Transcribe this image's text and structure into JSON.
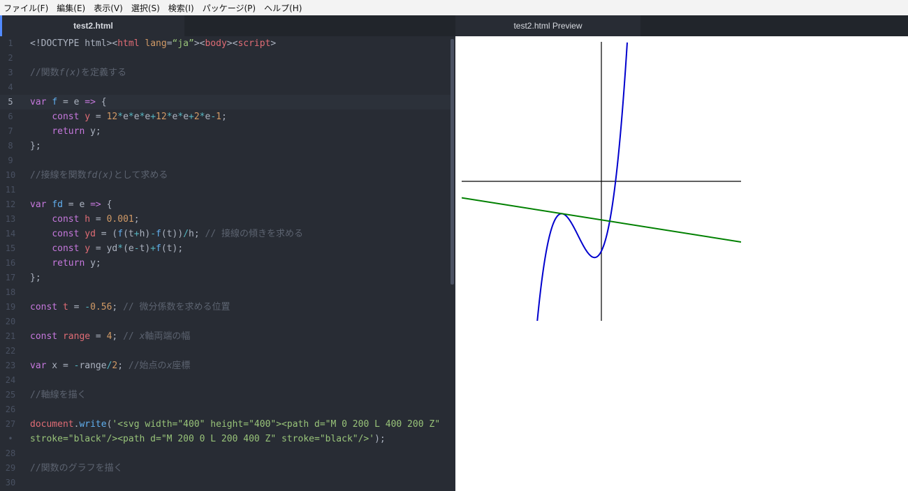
{
  "menu": [
    "ファイル(F)",
    "編集(E)",
    "表示(V)",
    "選択(S)",
    "検索(I)",
    "パッケージ(P)",
    "ヘルプ(H)"
  ],
  "tabs": {
    "editor": "test2.html",
    "preview": "test2.html Preview"
  },
  "editor": {
    "active_line": 5,
    "lines": [
      {
        "n": "1",
        "tokens": [
          [
            "<!DOCTYPE html>",
            "pl"
          ],
          [
            "<",
            "pl"
          ],
          [
            "html",
            "tag"
          ],
          [
            " ",
            "pl"
          ],
          [
            "lang",
            "attr"
          ],
          [
            "=",
            "pl"
          ],
          [
            "“ja”",
            "str"
          ],
          [
            ">",
            "pl"
          ],
          [
            "<",
            "pl"
          ],
          [
            "body",
            "tag"
          ],
          [
            "><",
            "pl"
          ],
          [
            "script",
            "tag"
          ],
          [
            ">",
            "pl"
          ]
        ]
      },
      {
        "n": "2",
        "tokens": []
      },
      {
        "n": "3",
        "tokens": [
          [
            "//関数",
            "cmt"
          ],
          [
            "f(x)",
            "cmt it"
          ],
          [
            "を定義する",
            "cmt"
          ]
        ]
      },
      {
        "n": "4",
        "tokens": []
      },
      {
        "n": "5",
        "tokens": [
          [
            "var",
            "kw"
          ],
          [
            " ",
            "pl"
          ],
          [
            "f",
            "fn"
          ],
          [
            " = e ",
            "pl"
          ],
          [
            "=>",
            "kw"
          ],
          [
            " {",
            "pl"
          ]
        ]
      },
      {
        "n": "6",
        "tokens": [
          [
            "    ",
            "pl"
          ],
          [
            "const",
            "kw"
          ],
          [
            " ",
            "pl"
          ],
          [
            "y",
            "var"
          ],
          [
            " = ",
            "pl"
          ],
          [
            "12",
            "num"
          ],
          [
            "*",
            "op"
          ],
          [
            "e",
            "pl"
          ],
          [
            "*",
            "op"
          ],
          [
            "e",
            "pl"
          ],
          [
            "*",
            "op"
          ],
          [
            "e",
            "pl"
          ],
          [
            "+",
            "op"
          ],
          [
            "12",
            "num"
          ],
          [
            "*",
            "op"
          ],
          [
            "e",
            "pl"
          ],
          [
            "*",
            "op"
          ],
          [
            "e",
            "pl"
          ],
          [
            "+",
            "op"
          ],
          [
            "2",
            "num"
          ],
          [
            "*",
            "op"
          ],
          [
            "e",
            "pl"
          ],
          [
            "-",
            "op"
          ],
          [
            "1",
            "num"
          ],
          [
            ";",
            "pl"
          ]
        ]
      },
      {
        "n": "7",
        "tokens": [
          [
            "    ",
            "pl"
          ],
          [
            "return",
            "kw"
          ],
          [
            " y;",
            "pl"
          ]
        ]
      },
      {
        "n": "8",
        "tokens": [
          [
            "};",
            "pl"
          ]
        ]
      },
      {
        "n": "9",
        "tokens": []
      },
      {
        "n": "10",
        "tokens": [
          [
            "//接線を関数",
            "cmt"
          ],
          [
            "fd(x)",
            "cmt it"
          ],
          [
            "として求める",
            "cmt"
          ]
        ]
      },
      {
        "n": "11",
        "tokens": []
      },
      {
        "n": "12",
        "tokens": [
          [
            "var",
            "kw"
          ],
          [
            " ",
            "pl"
          ],
          [
            "fd",
            "fn"
          ],
          [
            " = e ",
            "pl"
          ],
          [
            "=>",
            "kw"
          ],
          [
            " {",
            "pl"
          ]
        ]
      },
      {
        "n": "13",
        "tokens": [
          [
            "    ",
            "pl"
          ],
          [
            "const",
            "kw"
          ],
          [
            " ",
            "pl"
          ],
          [
            "h",
            "var"
          ],
          [
            " = ",
            "pl"
          ],
          [
            "0.001",
            "num"
          ],
          [
            ";",
            "pl"
          ]
        ]
      },
      {
        "n": "14",
        "tokens": [
          [
            "    ",
            "pl"
          ],
          [
            "const",
            "kw"
          ],
          [
            " ",
            "pl"
          ],
          [
            "yd",
            "var"
          ],
          [
            " = (",
            "pl"
          ],
          [
            "f",
            "fn"
          ],
          [
            "(t",
            "pl"
          ],
          [
            "+",
            "op"
          ],
          [
            "h)",
            "pl"
          ],
          [
            "-",
            "op"
          ],
          [
            "f",
            "fn"
          ],
          [
            "(t))",
            "pl"
          ],
          [
            "/",
            "op"
          ],
          [
            "h; ",
            "pl"
          ],
          [
            "// 接線の傾きを求める",
            "cmt"
          ]
        ]
      },
      {
        "n": "15",
        "tokens": [
          [
            "    ",
            "pl"
          ],
          [
            "const",
            "kw"
          ],
          [
            " ",
            "pl"
          ],
          [
            "y",
            "var"
          ],
          [
            " = yd",
            "pl"
          ],
          [
            "*",
            "op"
          ],
          [
            "(e",
            "pl"
          ],
          [
            "-",
            "op"
          ],
          [
            "t)",
            "pl"
          ],
          [
            "+",
            "op"
          ],
          [
            "f",
            "fn"
          ],
          [
            "(t);",
            "pl"
          ]
        ]
      },
      {
        "n": "16",
        "tokens": [
          [
            "    ",
            "pl"
          ],
          [
            "return",
            "kw"
          ],
          [
            " y;",
            "pl"
          ]
        ]
      },
      {
        "n": "17",
        "tokens": [
          [
            "};",
            "pl"
          ]
        ]
      },
      {
        "n": "18",
        "tokens": []
      },
      {
        "n": "19",
        "tokens": [
          [
            "const",
            "kw"
          ],
          [
            " ",
            "pl"
          ],
          [
            "t",
            "var"
          ],
          [
            " = ",
            "pl"
          ],
          [
            "-",
            "op"
          ],
          [
            "0.56",
            "num"
          ],
          [
            "; ",
            "pl"
          ],
          [
            "// 微分係数を求める位置",
            "cmt"
          ]
        ]
      },
      {
        "n": "20",
        "tokens": []
      },
      {
        "n": "21",
        "tokens": [
          [
            "const",
            "kw"
          ],
          [
            " ",
            "pl"
          ],
          [
            "range",
            "var"
          ],
          [
            " = ",
            "pl"
          ],
          [
            "4",
            "num"
          ],
          [
            "; ",
            "pl"
          ],
          [
            "// ",
            "cmt"
          ],
          [
            "x",
            "cmt it"
          ],
          [
            "軸両端の幅",
            "cmt"
          ]
        ]
      },
      {
        "n": "22",
        "tokens": []
      },
      {
        "n": "23",
        "tokens": [
          [
            "var",
            "kw"
          ],
          [
            " x = ",
            "pl"
          ],
          [
            "-",
            "op"
          ],
          [
            "range",
            "pl"
          ],
          [
            "/",
            "op"
          ],
          [
            "2",
            "num"
          ],
          [
            "; ",
            "pl"
          ],
          [
            "//始点の",
            "cmt"
          ],
          [
            "x",
            "cmt it"
          ],
          [
            "座標",
            "cmt"
          ]
        ]
      },
      {
        "n": "24",
        "tokens": []
      },
      {
        "n": "25",
        "tokens": [
          [
            "//軸線を描く",
            "cmt"
          ]
        ]
      },
      {
        "n": "26",
        "tokens": []
      },
      {
        "n": "27",
        "tokens": [
          [
            "document",
            "var"
          ],
          [
            ".",
            "pl"
          ],
          [
            "write",
            "fn"
          ],
          [
            "(",
            "pl"
          ],
          [
            "'<svg width=\"400\" height=\"400\"><path d=\"M 0 200 L 400 200 Z\"",
            "str"
          ]
        ]
      },
      {
        "n": "•",
        "tokens": [
          [
            "stroke=\"black\"/><path d=\"M 200 0 L 200 400 Z\" stroke=\"black\"/>'",
            "str"
          ],
          [
            ");",
            "pl"
          ]
        ]
      },
      {
        "n": "28",
        "tokens": []
      },
      {
        "n": "29",
        "tokens": [
          [
            "//関数のグラフを描く",
            "cmt"
          ]
        ]
      },
      {
        "n": "30",
        "tokens": []
      }
    ]
  },
  "preview": {
    "svg_size": 400,
    "t": -0.56,
    "range": 4,
    "colors": {
      "axis": "#000000",
      "curve": "#0000cd",
      "tangent": "#008000"
    }
  }
}
